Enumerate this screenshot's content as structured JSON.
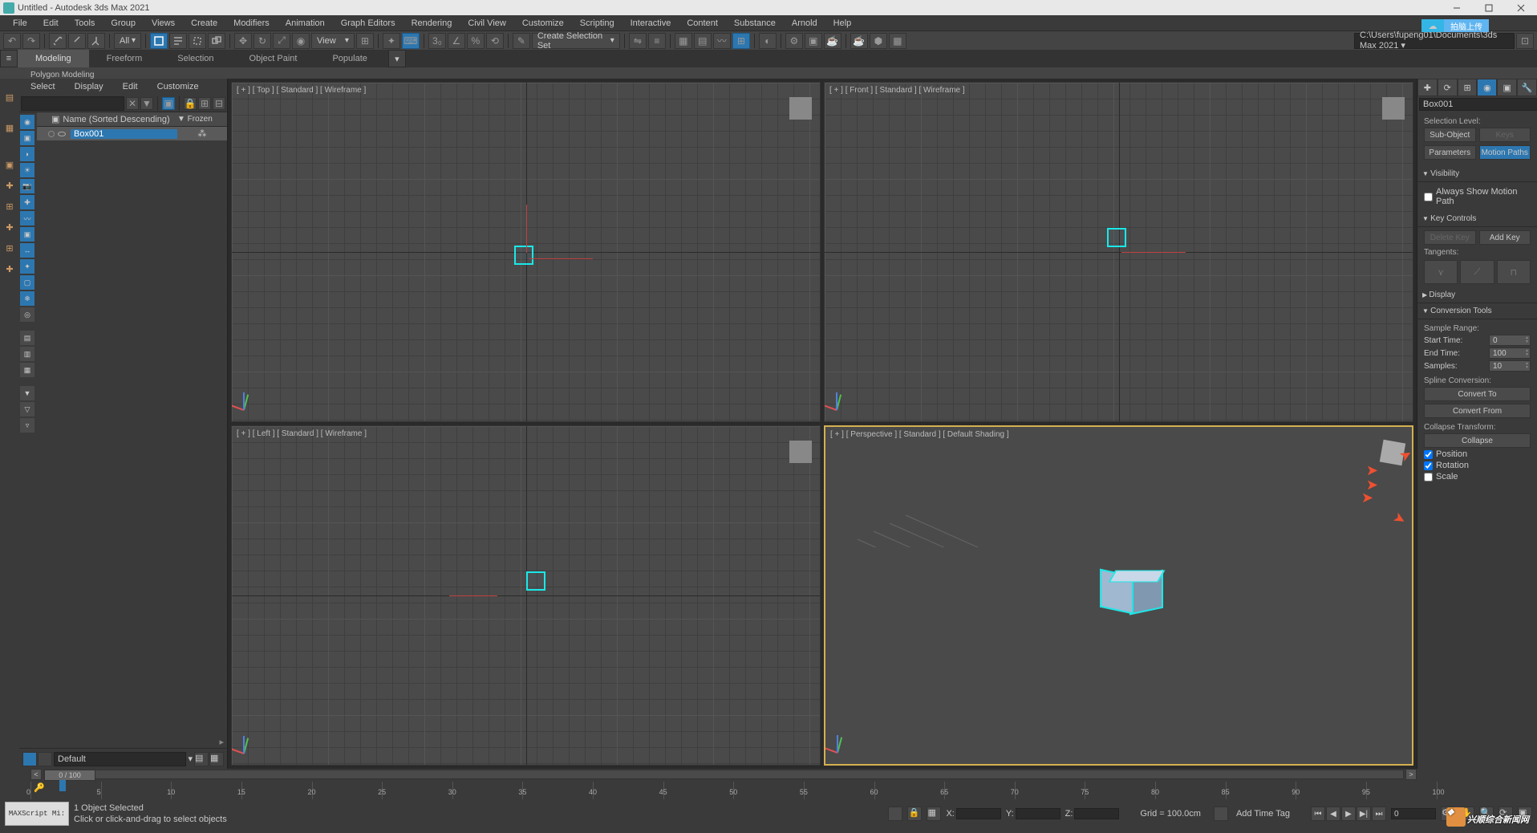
{
  "window": {
    "title": "Untitled - Autodesk 3ds Max 2021"
  },
  "menus": [
    "File",
    "Edit",
    "Tools",
    "Group",
    "Views",
    "Create",
    "Modifiers",
    "Animation",
    "Graph Editors",
    "Rendering",
    "Civil View",
    "Customize",
    "Scripting",
    "Interactive",
    "Content",
    "Substance",
    "Arnold",
    "Help"
  ],
  "cloud_btn": "拍脑上传",
  "toolbar": {
    "all_label": "All",
    "view_label": "View",
    "selection_set": "Create Selection Set",
    "project_path": "C:\\Users\\fupeng01\\Documents\\3ds Max 2021 ▾"
  },
  "ribbon": {
    "tabs": [
      "Modeling",
      "Freeform",
      "Selection",
      "Object Paint",
      "Populate"
    ],
    "sub": "Polygon Modeling"
  },
  "scene_explorer": {
    "menu": [
      "Select",
      "Display",
      "Edit",
      "Customize"
    ],
    "header_name": "Name (Sorted Descending)",
    "header_frozen": "▼ Frozen",
    "items": [
      {
        "name": "Box001"
      }
    ],
    "layer": "Default"
  },
  "viewports": {
    "top": "[ + ] [ Top ] [ Standard ] [ Wireframe ]",
    "front": "[ + ] [ Front ] [ Standard ] [ Wireframe ]",
    "left": "[ + ] [ Left ] [ Standard ] [ Wireframe ]",
    "persp": "[ + ] [ Perspective ] [ Standard ] [ Default Shading ]"
  },
  "cmd": {
    "object_name": "Box001",
    "selection_level": "Selection Level:",
    "sub_object": "Sub-Object",
    "keys": "Keys",
    "parameters": "Parameters",
    "motion_paths": "Motion Paths",
    "visibility": "Visibility",
    "always_show": "Always Show Motion Path",
    "key_controls": "Key Controls",
    "delete_key": "Delete Key",
    "add_key": "Add Key",
    "tangents": "Tangents:",
    "display": "Display",
    "conversion_tools": "Conversion Tools",
    "sample_range": "Sample Range:",
    "start_time": "Start Time:",
    "start_time_v": "0",
    "end_time": "End Time:",
    "end_time_v": "100",
    "samples": "Samples:",
    "samples_v": "10",
    "spline_conv": "Spline Conversion:",
    "convert_to": "Convert To",
    "convert_from": "Convert From",
    "collapse_transform": "Collapse Transform:",
    "collapse": "Collapse",
    "position": "Position",
    "rotation": "Rotation",
    "scale": "Scale"
  },
  "timeline": {
    "range": "0 / 100",
    "ticks": [
      "0",
      "5",
      "10",
      "15",
      "20",
      "25",
      "30",
      "35",
      "40",
      "45",
      "50",
      "55",
      "60",
      "65",
      "70",
      "75",
      "80",
      "85",
      "90",
      "95",
      "100"
    ]
  },
  "status": {
    "script": "MAXScript Mi:",
    "sel": "1 Object Selected",
    "hint": "Click or click-and-drag to select objects",
    "x": "X:",
    "y": "Y:",
    "z": "Z:",
    "grid": "Grid = 100.0cm",
    "add_tag": "Add Time Tag",
    "frame": "0"
  },
  "watermark": "兴顺综合新闻网"
}
